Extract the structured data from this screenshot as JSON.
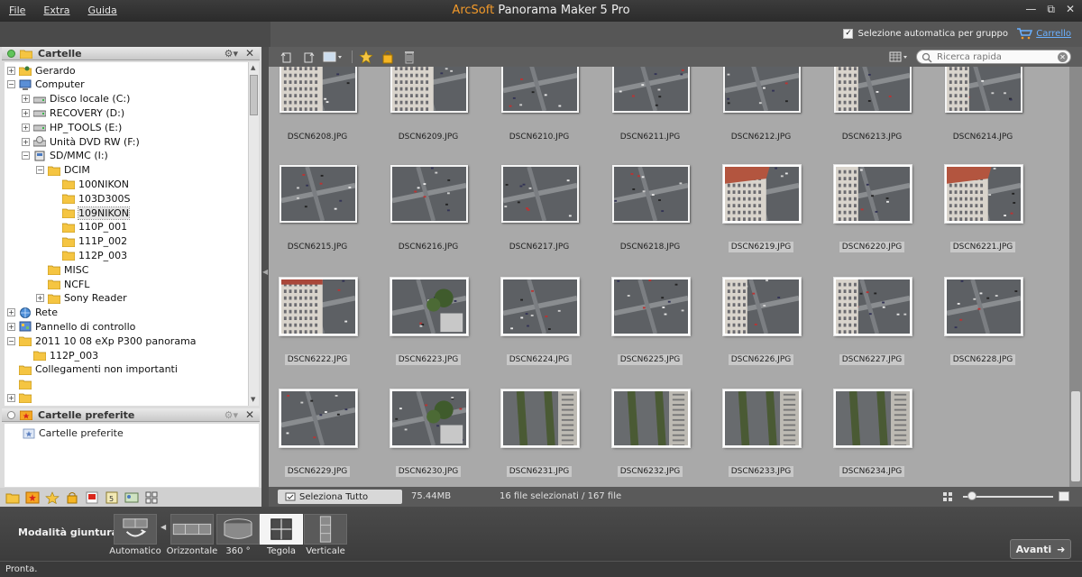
{
  "titlebar": {
    "menu": [
      "File",
      "Extra",
      "Guida"
    ],
    "brand": "ArcSoft",
    "title": "Panorama Maker 5 Pro",
    "controls": [
      "minimize-icon",
      "restore-icon",
      "close-icon"
    ]
  },
  "topbar": {
    "auto_group_label": "Selezione automatica per gruppo",
    "auto_group_checked": true,
    "cart_label": "Carrello"
  },
  "folders_panel": {
    "title": "Cartelle",
    "tree": [
      {
        "label": "Gerardo",
        "icon": "user-folder-icon",
        "expand": "+",
        "level": 0
      },
      {
        "label": "Computer",
        "icon": "computer-icon",
        "expand": "-",
        "level": 0
      },
      {
        "label": "Disco locale (C:)",
        "icon": "hard-drive-icon",
        "expand": "+",
        "level": 1
      },
      {
        "label": "RECOVERY (D:)",
        "icon": "hard-drive-icon",
        "expand": "+",
        "level": 1
      },
      {
        "label": "HP_TOOLS (E:)",
        "icon": "hard-drive-icon",
        "expand": "+",
        "level": 1
      },
      {
        "label": "Unità DVD RW (F:)",
        "icon": "dvd-drive-icon",
        "expand": "+",
        "level": 1
      },
      {
        "label": "SD/MMC (I:)",
        "icon": "sd-card-icon",
        "expand": "-",
        "level": 1
      },
      {
        "label": "DCIM",
        "icon": "folder-icon",
        "expand": "-",
        "level": 2
      },
      {
        "label": "100NIKON",
        "icon": "folder-icon",
        "expand": "",
        "level": 3
      },
      {
        "label": "103D300S",
        "icon": "folder-icon",
        "expand": "",
        "level": 3
      },
      {
        "label": "109NIKON",
        "icon": "folder-icon",
        "expand": "",
        "level": 3,
        "selected": true
      },
      {
        "label": "110P_001",
        "icon": "folder-icon",
        "expand": "",
        "level": 3
      },
      {
        "label": "111P_002",
        "icon": "folder-icon",
        "expand": "",
        "level": 3
      },
      {
        "label": "112P_003",
        "icon": "folder-icon",
        "expand": "",
        "level": 3
      },
      {
        "label": "MISC",
        "icon": "folder-icon",
        "expand": "",
        "level": 2
      },
      {
        "label": "NCFL",
        "icon": "folder-icon",
        "expand": "",
        "level": 2
      },
      {
        "label": "Sony Reader",
        "icon": "folder-icon",
        "expand": "+",
        "level": 2
      },
      {
        "label": "Rete",
        "icon": "network-icon",
        "expand": "+",
        "level": 0
      },
      {
        "label": "Pannello di controllo",
        "icon": "control-panel-icon",
        "expand": "+",
        "level": 0
      },
      {
        "label": "2011 10 08 eXp P300 panorama",
        "icon": "folder-icon",
        "expand": "-",
        "level": 0
      },
      {
        "label": "112P_003",
        "icon": "folder-icon",
        "expand": "",
        "level": 1
      },
      {
        "label": "Collegamenti non importanti",
        "icon": "folder-icon",
        "expand": "",
        "level": 0
      },
      {
        "label": "",
        "icon": "folder-icon",
        "expand": "",
        "level": 0
      },
      {
        "label": "",
        "icon": "folder-icon",
        "expand": "+",
        "level": 0
      }
    ]
  },
  "favorites_panel": {
    "title": "Cartelle preferite",
    "items": [
      "Cartelle preferite"
    ]
  },
  "thumb_toolbar": {
    "search_placeholder": "Ricerca rapida"
  },
  "thumbnails": [
    {
      "name": "DSCN6208.JPG",
      "sel": false,
      "scene": "building"
    },
    {
      "name": "DSCN6209.JPG",
      "sel": false,
      "scene": "building"
    },
    {
      "name": "DSCN6210.JPG",
      "sel": false,
      "scene": "street"
    },
    {
      "name": "DSCN6211.JPG",
      "sel": false,
      "scene": "street"
    },
    {
      "name": "DSCN6212.JPG",
      "sel": false,
      "scene": "street"
    },
    {
      "name": "DSCN6213.JPG",
      "sel": false,
      "scene": "buildleft"
    },
    {
      "name": "DSCN6214.JPG",
      "sel": false,
      "scene": "buildleft"
    },
    {
      "name": "DSCN6215.JPG",
      "sel": false,
      "scene": "street"
    },
    {
      "name": "DSCN6216.JPG",
      "sel": false,
      "scene": "street"
    },
    {
      "name": "DSCN6217.JPG",
      "sel": false,
      "scene": "street"
    },
    {
      "name": "DSCN6218.JPG",
      "sel": false,
      "scene": "street"
    },
    {
      "name": "DSCN6219.JPG",
      "sel": true,
      "scene": "roof"
    },
    {
      "name": "DSCN6220.JPG",
      "sel": true,
      "scene": "buildleft"
    },
    {
      "name": "DSCN6221.JPG",
      "sel": true,
      "scene": "roof"
    },
    {
      "name": "DSCN6222.JPG",
      "sel": true,
      "scene": "building"
    },
    {
      "name": "DSCN6223.JPG",
      "sel": true,
      "scene": "trees"
    },
    {
      "name": "DSCN6224.JPG",
      "sel": true,
      "scene": "street"
    },
    {
      "name": "DSCN6225.JPG",
      "sel": true,
      "scene": "street"
    },
    {
      "name": "DSCN6226.JPG",
      "sel": true,
      "scene": "buildleft"
    },
    {
      "name": "DSCN6227.JPG",
      "sel": true,
      "scene": "buildleft"
    },
    {
      "name": "DSCN6228.JPG",
      "sel": true,
      "scene": "street"
    },
    {
      "name": "DSCN6229.JPG",
      "sel": true,
      "scene": "street"
    },
    {
      "name": "DSCN6230.JPG",
      "sel": true,
      "scene": "trees"
    },
    {
      "name": "DSCN6231.JPG",
      "sel": true,
      "scene": "avenue"
    },
    {
      "name": "DSCN6232.JPG",
      "sel": true,
      "scene": "avenue"
    },
    {
      "name": "DSCN6233.JPG",
      "sel": true,
      "scene": "avenue"
    },
    {
      "name": "DSCN6234.JPG",
      "sel": true,
      "scene": "avenue"
    }
  ],
  "status_row": {
    "select_all": "Seleziona Tutto",
    "size": "75.44MB",
    "count": "16 file selezionati / 167 file",
    "zoom_level": 0.05
  },
  "modebar": {
    "label": "Modalità giuntura:",
    "modes": [
      {
        "label": "Automatico",
        "active": false
      },
      {
        "label": "Orizzontale",
        "active": false
      },
      {
        "label": "360 °",
        "active": false
      },
      {
        "label": "Tegola",
        "active": true
      },
      {
        "label": "Verticale",
        "active": false
      }
    ],
    "next_button": "Avanti"
  },
  "statusbar": {
    "text": "Pronta."
  },
  "colors": {
    "brand": "#f39a2a",
    "link": "#6ab0ff",
    "grid_bg": "#a9a9a9"
  }
}
